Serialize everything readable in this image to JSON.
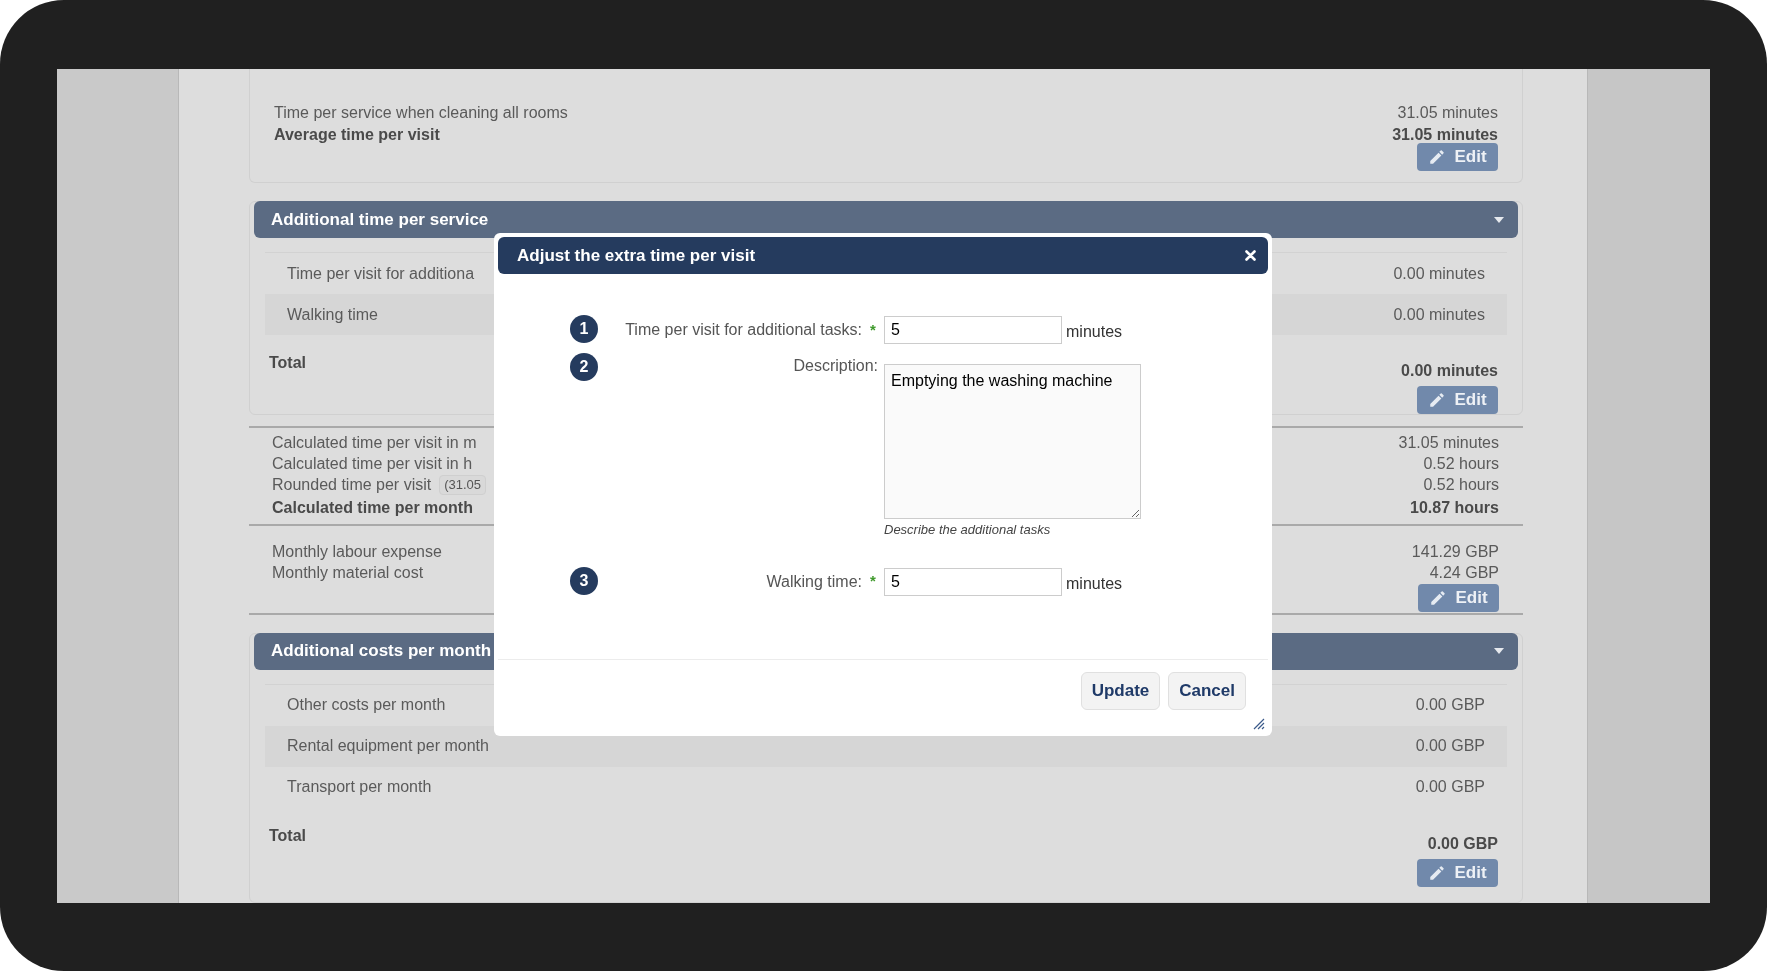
{
  "summary": {
    "rows": [
      {
        "label": "Time per service when cleaning all rooms",
        "value": "31.05 minutes",
        "bold": false
      },
      {
        "label": "Average time per visit",
        "value": "31.05 minutes",
        "bold": true
      }
    ],
    "edit_button": "Edit"
  },
  "time_section": {
    "title": "Additional time per service",
    "rows": [
      {
        "label": "Time per visit for additiona",
        "value": "0.00 minutes"
      },
      {
        "label": "Walking time",
        "value": "0.00 minutes"
      }
    ],
    "total": {
      "label": "Total",
      "value": "0.00 minutes"
    },
    "edit_button": "Edit"
  },
  "calculations": [
    {
      "label": "Calculated time per visit in m",
      "value": "31.05 minutes",
      "bold": false
    },
    {
      "label": "Calculated time per visit in h",
      "value": "0.52 hours",
      "bold": false
    },
    {
      "label": "Rounded time per visit",
      "badge": "(31.05",
      "value": "0.52 hours",
      "bold": false
    },
    {
      "label": "Calculated time per month",
      "value": "10.87 hours",
      "bold": true
    }
  ],
  "costs": {
    "rows": [
      {
        "label": "Monthly labour expense",
        "value": "141.29 GBP"
      },
      {
        "label": "Monthly material cost",
        "value": "4.24 GBP"
      }
    ],
    "edit_button": "Edit"
  },
  "cost_section": {
    "title": "Additional costs per month",
    "rows": [
      {
        "label": "Other costs per month",
        "value": "0.00 GBP"
      },
      {
        "label": "Rental equipment per month",
        "value": "0.00 GBP"
      },
      {
        "label": "Transport per month",
        "value": "0.00 GBP"
      }
    ],
    "total": {
      "label": "Total",
      "value": "0.00 GBP"
    },
    "edit_button": "Edit"
  },
  "dialog": {
    "title": "Adjust the extra time per visit",
    "fields": [
      {
        "number": "1",
        "label": "Time per visit for additional tasks:",
        "required_mark": "*",
        "kind": "input",
        "value": "5",
        "unit": "minutes"
      },
      {
        "number": "2",
        "label": "Description:",
        "kind": "textarea",
        "value": "Emptying the washing machine",
        "help": "Describe the additional tasks"
      },
      {
        "number": "3",
        "label": "Walking time:",
        "required_mark": "*",
        "kind": "input",
        "value": "5",
        "unit": "minutes"
      }
    ],
    "buttons": [
      "Update",
      "Cancel"
    ]
  }
}
